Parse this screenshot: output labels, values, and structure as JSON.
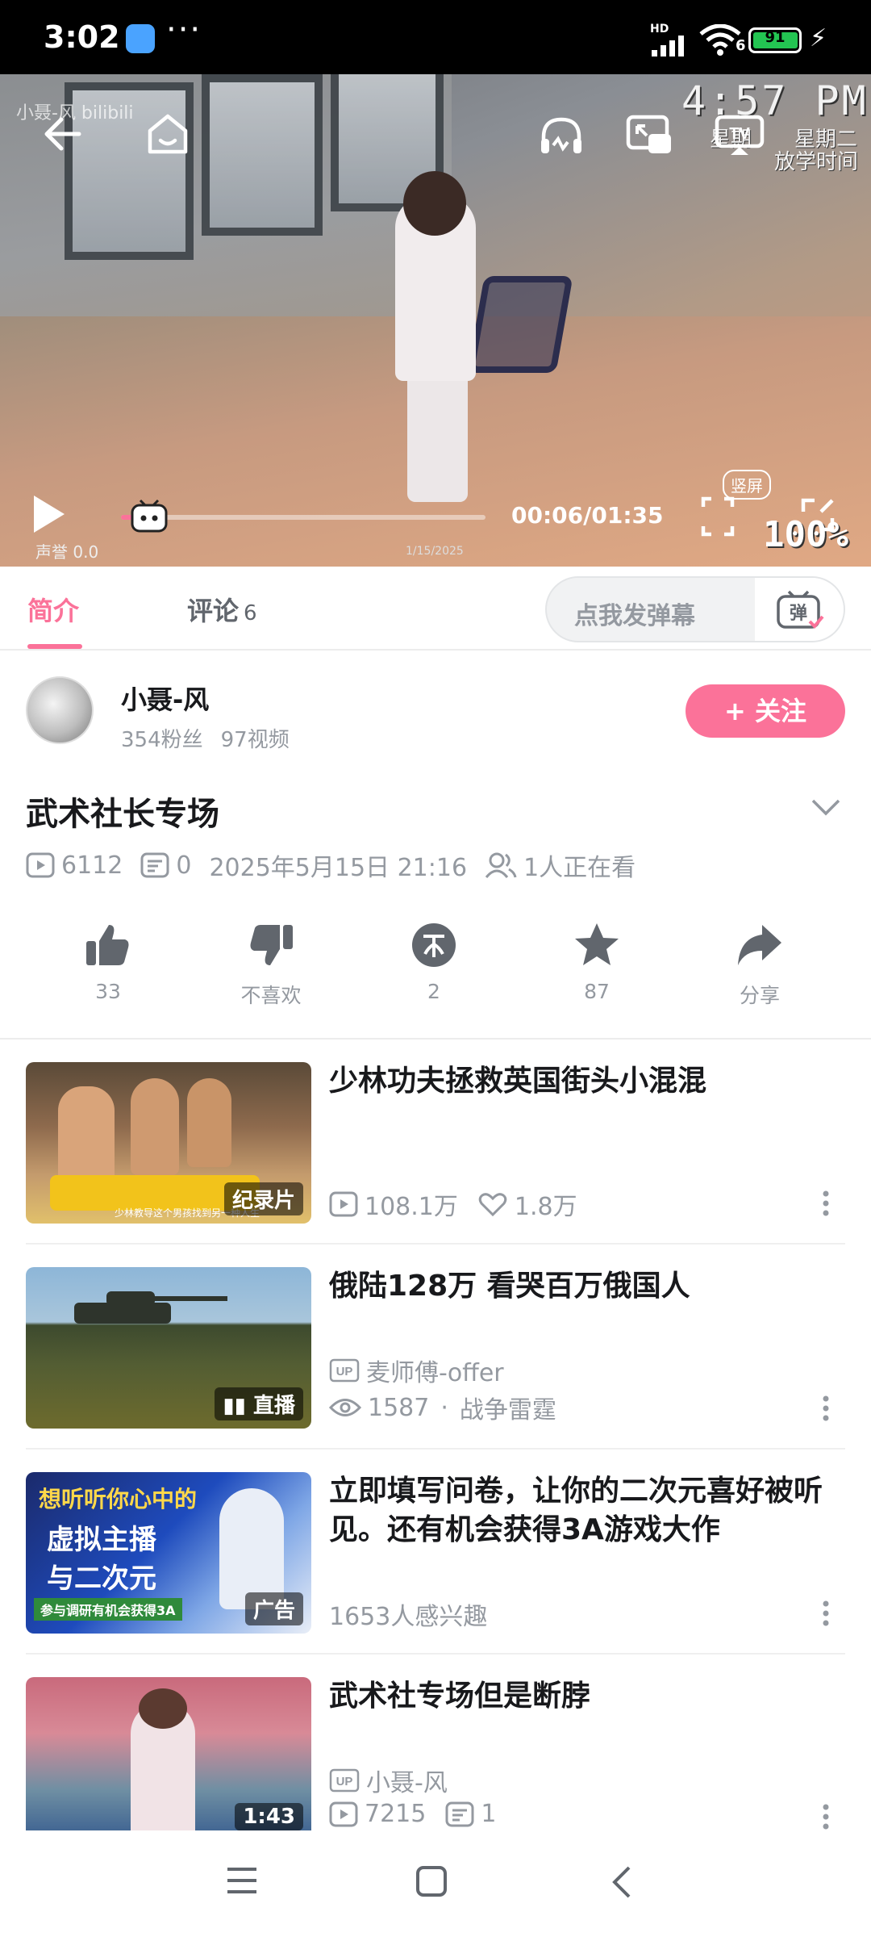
{
  "status_bar": {
    "time": "3:02",
    "dots": "···",
    "network": "HD",
    "wifi_sub": "6",
    "battery": "91"
  },
  "video": {
    "watermark": "小聂-风 bilibili",
    "osd_clock": "4:57 PM",
    "osd_day1": "星期",
    "osd_day2": "星期二",
    "osd_after_school": "放学时间",
    "osd_fame": "声誉 0.0",
    "osd_date": "1/15/2025",
    "osd_zoom": "100%",
    "time_display": "00:06/01:35",
    "portrait_label": "竖屏",
    "progress_fraction": 0.063
  },
  "tabs": {
    "intro": "简介",
    "comments": "评论",
    "comments_count": "6",
    "danmaku_placeholder": "点我发弹幕",
    "danmaku_button": "弹"
  },
  "uploader": {
    "name": "小聂-风",
    "followers": "354粉丝",
    "videos": "97视频",
    "follow_label": "+ 关注"
  },
  "video_info": {
    "title": "武术社长专场",
    "plays": "6112",
    "danmaku": "0",
    "date": "2025年5月15日 21:16",
    "watching": "1人正在看"
  },
  "actions": {
    "like": "33",
    "dislike": "不喜欢",
    "coin": "2",
    "favorite": "87",
    "share": "分享"
  },
  "feed": [
    {
      "title": "少林功夫拯救英国街头小混混",
      "badge": "纪录片",
      "plays": "108.1万",
      "likes": "1.8万",
      "thumb_caption": "少林教导这个男孩找到另一种人生"
    },
    {
      "title": "俄陆128万 看哭百万俄国人",
      "badge": "直播",
      "up": "麦师傅-offer",
      "views": "1587",
      "category": "战争雷霆"
    },
    {
      "title": "立即填写问卷，让你的二次元喜好被听见。还有机会获得3A游戏大作",
      "badge": "广告",
      "interest": "1653人感兴趣",
      "thumb_line1": "想听听你心中的",
      "thumb_line2": "虚拟主播",
      "thumb_line3": "与二次元",
      "thumb_line4": "参与调研有机会获得3A"
    },
    {
      "title": "武术社专场但是断脖",
      "badge": "1:43",
      "up": "小聂-风",
      "plays": "7215",
      "danmaku": "1"
    }
  ],
  "colors": {
    "accent": "#fb7299",
    "muted": "#9499a0",
    "text": "#18191c"
  }
}
